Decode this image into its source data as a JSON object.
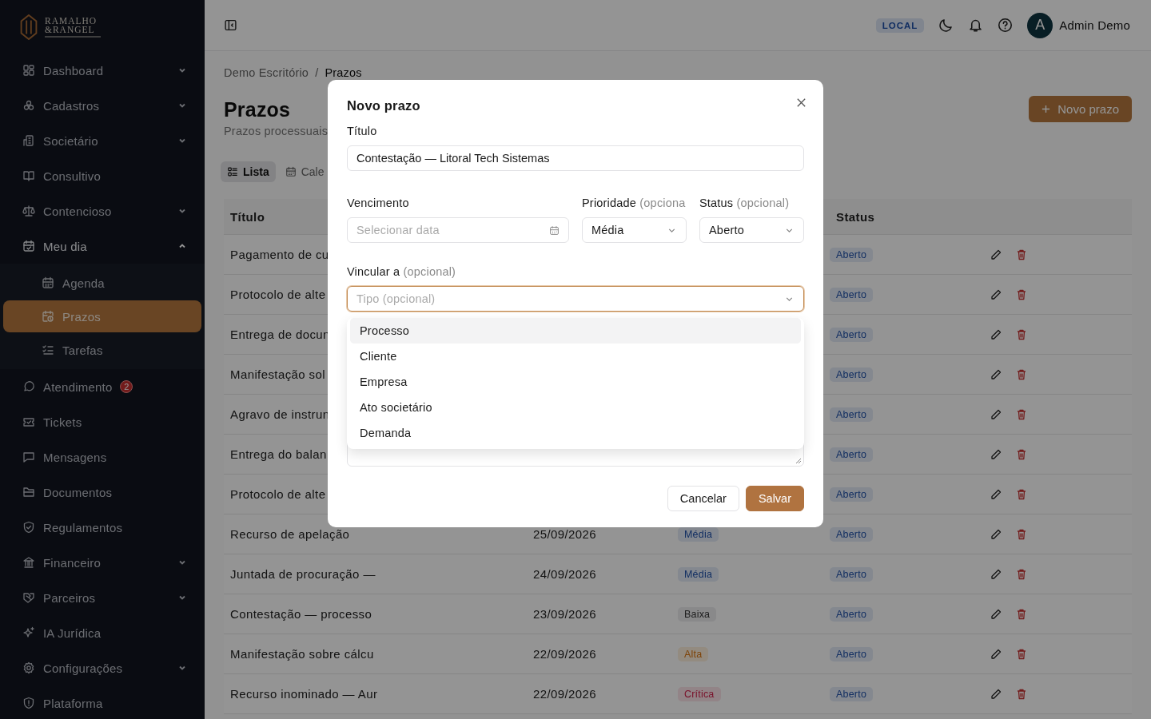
{
  "sidebar": {
    "brand": {
      "line_1": "RAMALHO",
      "line_2": "&RANGEL"
    },
    "items": [
      {
        "label": "Dashboard",
        "expanded": false,
        "selected": false
      },
      {
        "label": "Cadastros",
        "expanded": false,
        "selected": false
      },
      {
        "label": "Societário",
        "expanded": false,
        "selected": false
      },
      {
        "label": "Consultivo",
        "selected": false
      },
      {
        "label": "Contencioso",
        "expanded": false,
        "selected": false
      },
      {
        "label": "Meu dia",
        "expanded": true,
        "selected": false,
        "children": [
          {
            "label": "Agenda",
            "selected": false
          },
          {
            "label": "Prazos",
            "selected": true
          },
          {
            "label": "Tarefas",
            "selected": false
          }
        ]
      },
      {
        "label": "Atendimento",
        "selected": false,
        "badge": "2"
      },
      {
        "label": "Tickets",
        "selected": false
      },
      {
        "label": "Mensagens",
        "selected": false
      },
      {
        "label": "Documentos",
        "selected": false
      },
      {
        "label": "Regulamentos",
        "selected": false
      },
      {
        "label": "Financeiro",
        "expanded": false,
        "selected": false
      },
      {
        "label": "Parceiros",
        "expanded": false,
        "selected": false
      },
      {
        "label": "IA Jurídica",
        "selected": false
      },
      {
        "label": "Configurações",
        "expanded": false,
        "selected": false
      },
      {
        "label": "Plataforma",
        "selected": false
      }
    ]
  },
  "header": {
    "environment_badge": "LOCAL",
    "avatar_initial": "A",
    "user_name": "Admin Demo"
  },
  "breadcrumb": {
    "items": [
      "Demo Escritório",
      "Prazos"
    ],
    "separator": "/"
  },
  "page": {
    "title": "Prazos",
    "subtitle": "Prazos processuais",
    "primary_button": "Novo prazo",
    "view_tabs": [
      {
        "label": "Lista",
        "selected": true
      },
      {
        "label": "Cale",
        "selected": false
      }
    ]
  },
  "table": {
    "header": {
      "title": "Título",
      "status": "Status"
    },
    "rows": [
      {
        "title": "Pagamento de cu",
        "status": "Aberto"
      },
      {
        "title": "Protocolo de alte",
        "status": "Aberto"
      },
      {
        "title": "Entrega de docun",
        "status": "Aberto"
      },
      {
        "title": "Manifestação sol",
        "status": "Aberto"
      },
      {
        "title": "Agravo de instrun",
        "status": "Aberto"
      },
      {
        "title": "Entrega do balan",
        "status": "Aberto"
      },
      {
        "title": "Protocolo de alte",
        "status": "Aberto"
      },
      {
        "title": "Recurso de apelação",
        "due": "25/09/2026",
        "priority": {
          "label": "Média",
          "kind": "medium"
        },
        "status": "Aberto"
      },
      {
        "title": "Juntada de procuração —",
        "due": "24/09/2026",
        "priority": {
          "label": "Média",
          "kind": "medium"
        },
        "status": "Aberto"
      },
      {
        "title": "Contestação — processo",
        "due": "23/09/2026",
        "priority": {
          "label": "Baixa",
          "kind": "low"
        },
        "status": "Aberto"
      },
      {
        "title": "Manifestação sobre cálcu",
        "due": "22/09/2026",
        "priority": {
          "label": "Alta",
          "kind": "high"
        },
        "status": "Aberto"
      },
      {
        "title": "Recurso inominado — Aur",
        "due": "22/09/2026",
        "priority": {
          "label": "Crítica",
          "kind": "critical"
        },
        "status": "Aberto"
      }
    ]
  },
  "modal": {
    "title": "Novo prazo",
    "title_field": {
      "label": "Título",
      "value": "Contestação — Litoral Tech Sistemas"
    },
    "due_field": {
      "label": "Vencimento",
      "placeholder": "Selecionar data"
    },
    "priority_field": {
      "label": "Prioridade",
      "hint": "(opciona",
      "value": "Média"
    },
    "status_field": {
      "label": "Status",
      "hint": "(opcional)",
      "value": "Aberto"
    },
    "link_field": {
      "label": "Vincular a",
      "hint": "(opcional)",
      "placeholder": "Tipo (opcional)",
      "open": true,
      "options": [
        {
          "label": "Processo",
          "highlighted": true
        },
        {
          "label": "Cliente",
          "highlighted": false
        },
        {
          "label": "Empresa",
          "highlighted": false
        },
        {
          "label": "Ato societário",
          "highlighted": false
        },
        {
          "label": "Demanda",
          "highlighted": false
        }
      ]
    },
    "buttons": {
      "cancel": "Cancelar",
      "save": "Salvar"
    }
  }
}
